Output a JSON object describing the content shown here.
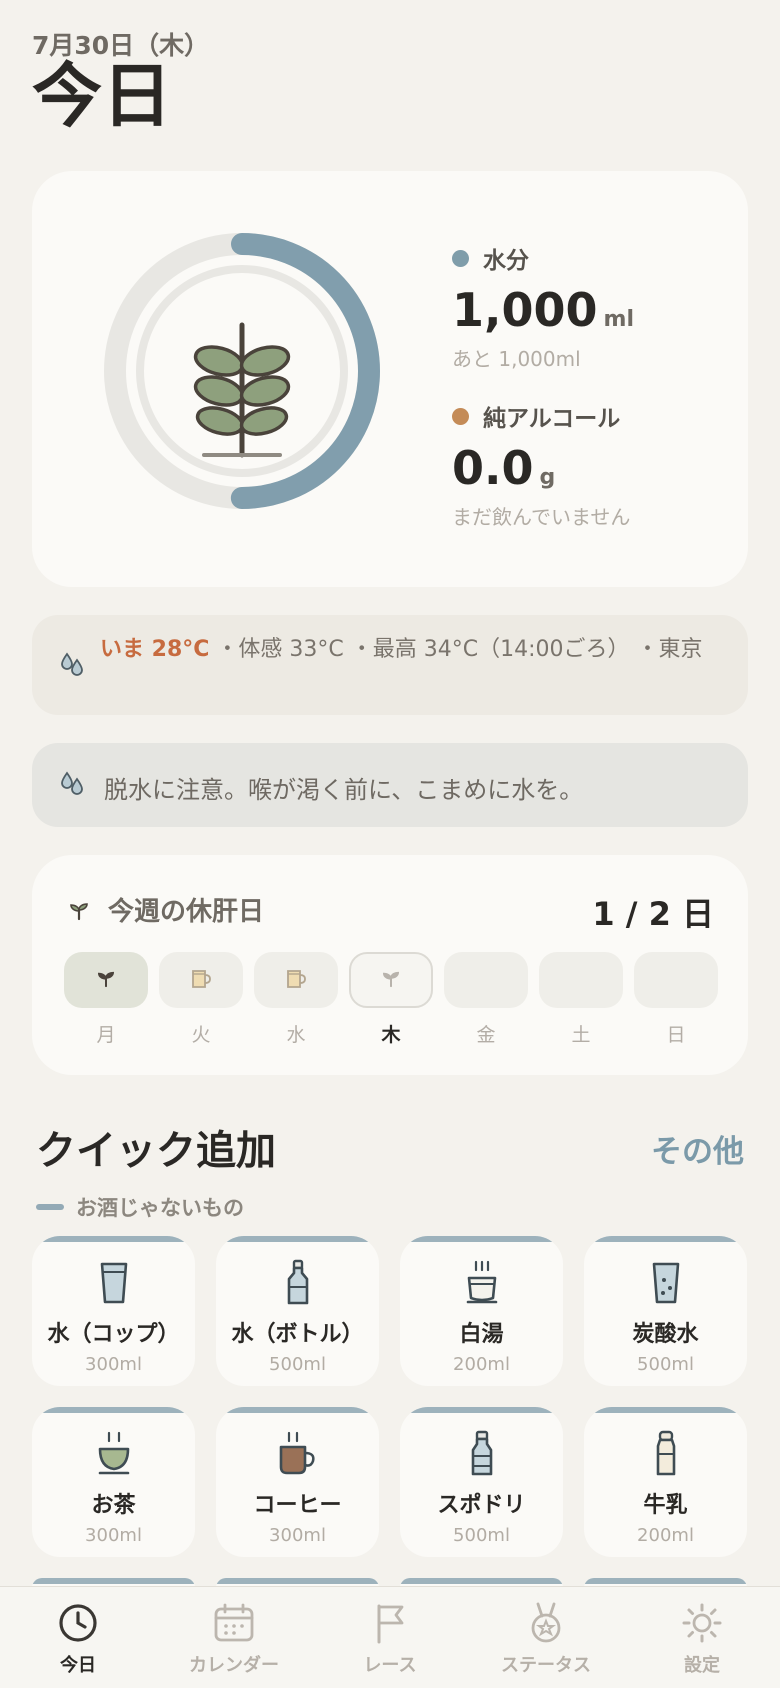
{
  "header": {
    "date": "7月30日（木）",
    "title": "今日"
  },
  "progress": {
    "water_fraction": 0.5
  },
  "water": {
    "label": "水分",
    "value": "1,000",
    "unit": "ml",
    "sub": "あと 1,000ml",
    "color": "#7f9daa"
  },
  "alcohol": {
    "label": "純アルコール",
    "value": "0.0",
    "unit": "g",
    "sub": "まだ飲んでいません",
    "color": "#c48b57"
  },
  "weather": {
    "now": "いま 28°C",
    "detail": " ・体感 33°C ・最高 34°C（14:00ごろ） ・東京"
  },
  "alert": {
    "text": "脱水に注意。喉が渇く前に、こまめに水を。"
  },
  "week": {
    "title": "今週の休肝日",
    "count": "1 / 2 日",
    "days": [
      {
        "label": "月",
        "state": "rest"
      },
      {
        "label": "火",
        "state": "drink"
      },
      {
        "label": "水",
        "state": "drink"
      },
      {
        "label": "木",
        "state": "today"
      },
      {
        "label": "金",
        "state": "empty"
      },
      {
        "label": "土",
        "state": "empty"
      },
      {
        "label": "日",
        "state": "empty"
      }
    ]
  },
  "quick_add": {
    "title": "クイック追加",
    "more": "その他",
    "section": "お酒じゃないもの",
    "items": [
      {
        "name": "水（コップ）",
        "volume": "300ml",
        "icon": "glass-icon"
      },
      {
        "name": "水（ボトル）",
        "volume": "500ml",
        "icon": "bottle-icon"
      },
      {
        "name": "白湯",
        "volume": "200ml",
        "icon": "hot-water-cup-icon"
      },
      {
        "name": "炭酸水",
        "volume": "500ml",
        "icon": "sparkling-glass-icon"
      },
      {
        "name": "お茶",
        "volume": "300ml",
        "icon": "tea-cup-icon"
      },
      {
        "name": "コーヒー",
        "volume": "300ml",
        "icon": "coffee-cup-icon"
      },
      {
        "name": "スポドリ",
        "volume": "500ml",
        "icon": "sports-drink-bottle-icon"
      },
      {
        "name": "牛乳",
        "volume": "200ml",
        "icon": "milk-bottle-icon"
      }
    ]
  },
  "tabs": [
    {
      "label": "今日",
      "icon": "clock-icon",
      "active": true
    },
    {
      "label": "カレンダー",
      "icon": "calendar-icon",
      "active": false
    },
    {
      "label": "レース",
      "icon": "flag-icon",
      "active": false
    },
    {
      "label": "ステータス",
      "icon": "medal-icon",
      "active": false
    },
    {
      "label": "設定",
      "icon": "gear-icon",
      "active": false
    }
  ]
}
